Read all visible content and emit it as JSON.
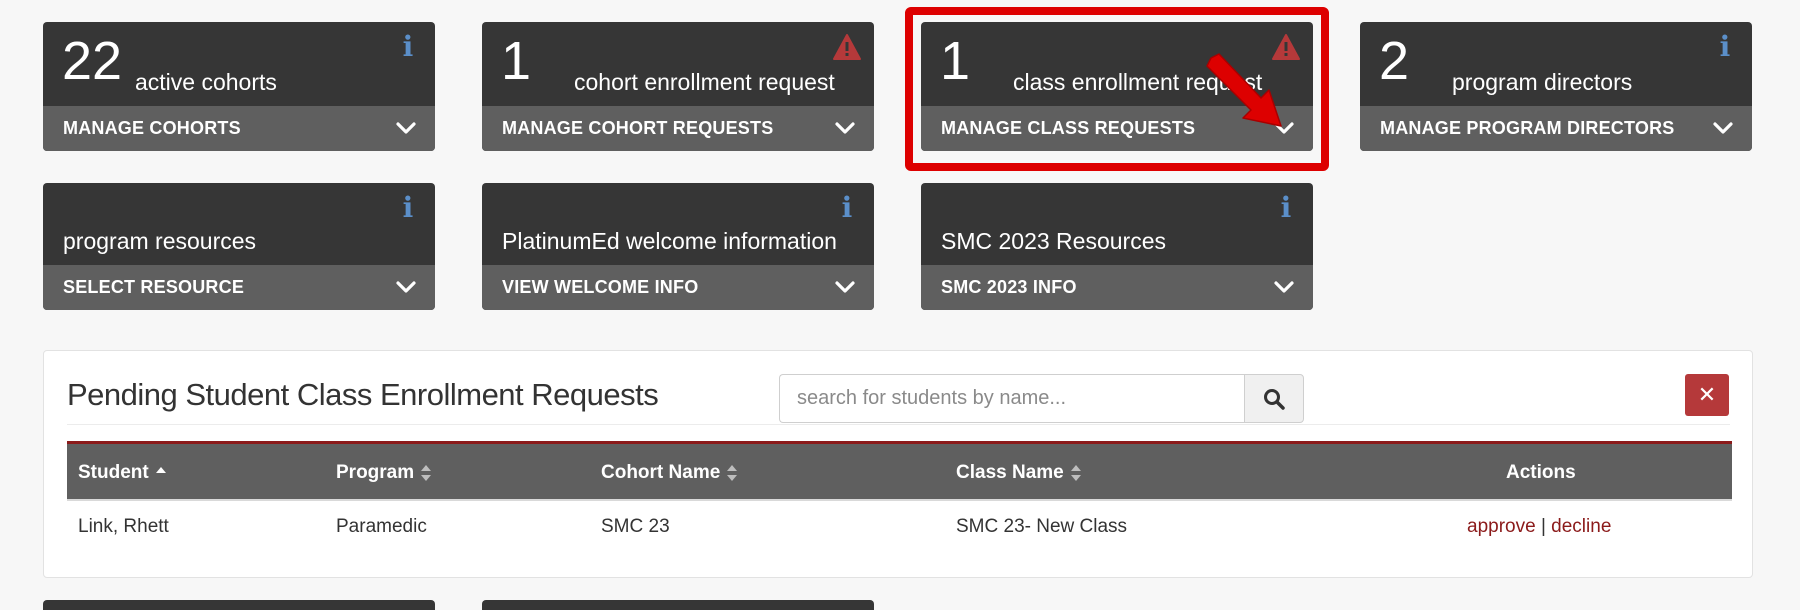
{
  "cards": [
    {
      "number": "22",
      "label": "active cohorts",
      "button": "MANAGE COHORTS",
      "badge": "info-icon",
      "badge_text": "i"
    },
    {
      "number": "1",
      "label": "cohort enrollment request",
      "button": "MANAGE COHORT REQUESTS",
      "badge": "warning-icon"
    },
    {
      "number": "1",
      "label": "class enrollment request",
      "button": "MANAGE CLASS REQUESTS",
      "badge": "warning-icon"
    },
    {
      "number": "2",
      "label": "program directors",
      "button": "MANAGE PROGRAM DIRECTORS",
      "badge": "info-icon",
      "badge_text": "i"
    },
    {
      "label": "program resources",
      "button": "SELECT RESOURCE",
      "badge": "info-icon",
      "badge_text": "i"
    },
    {
      "label": "PlatinumEd welcome information",
      "button": "VIEW WELCOME INFO",
      "badge": "info-icon",
      "badge_text": "i"
    },
    {
      "label": "SMC 2023 Resources",
      "button": "SMC 2023 INFO",
      "badge": "info-icon",
      "badge_text": "i"
    }
  ],
  "panel": {
    "title": "Pending Student Class Enrollment Requests",
    "search_placeholder": "search for students by name...",
    "search_value": "",
    "close_glyph": "✕",
    "columns": [
      {
        "label": "Student",
        "sort": "ascending"
      },
      {
        "label": "Program",
        "sort": "both"
      },
      {
        "label": "Cohort Name",
        "sort": "both"
      },
      {
        "label": "Class Name",
        "sort": "both"
      },
      {
        "label": "Actions",
        "sort": "none"
      }
    ],
    "rows": [
      {
        "student": "Link, Rhett",
        "program": "Paramedic",
        "cohort": "SMC 23",
        "class": "SMC 23- New Class",
        "approve": "approve",
        "separator": "|",
        "decline": "decline"
      }
    ]
  },
  "colors": {
    "card_bg": "#363636",
    "card_bar": "#5f5f5f",
    "info_icon": "#5b8fc9",
    "warning_icon": "#b5393a",
    "highlight": "#dd0000",
    "link": "#8b1a1a",
    "close_button": "#b5393a"
  }
}
